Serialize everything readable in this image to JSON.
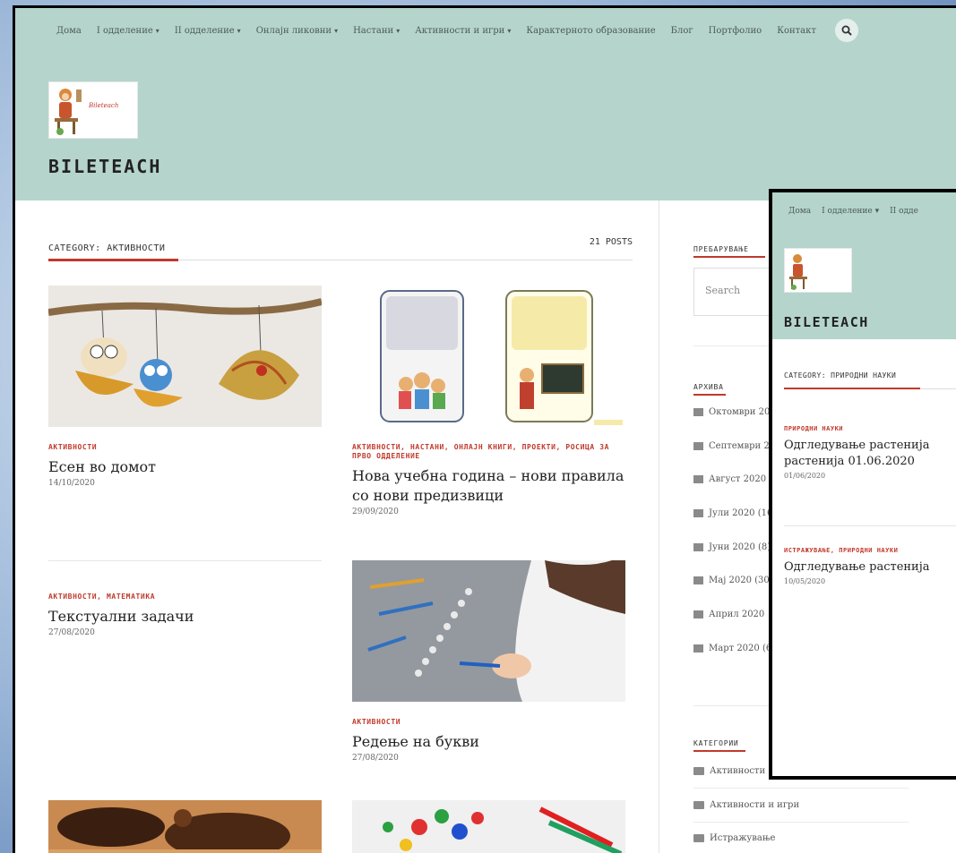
{
  "nav": {
    "items": [
      {
        "label": "Дома",
        "caret": false
      },
      {
        "label": "I одделение",
        "caret": true
      },
      {
        "label": "II одделение",
        "caret": true
      },
      {
        "label": "Онлајн ликовни",
        "caret": true
      },
      {
        "label": "Настани",
        "caret": true
      },
      {
        "label": "Активности и игри",
        "caret": true
      },
      {
        "label": "Карактерното образование",
        "caret": false
      },
      {
        "label": "Блог",
        "caret": false
      },
      {
        "label": "Портфолио",
        "caret": false
      },
      {
        "label": "Контакт",
        "caret": false
      }
    ],
    "caret_glyph": "▾",
    "search_icon": "search-icon"
  },
  "header": {
    "logo_text": "Biletеach",
    "site_title": "BILETEACH"
  },
  "archive": {
    "category_label": "CATEGORY: АКТИВНОСТИ",
    "post_count": "21 POSTS"
  },
  "posts": [
    {
      "categories": "АКТИВНОСТИ",
      "title": "Есен во домот",
      "date": "14/10/2020"
    },
    {
      "categories": "АКТИВНОСТИ, НАСТАНИ, ОНЛАЈН КНИГИ, ПРОЕКТИ, РОСИЦА ЗА ПРВО ОДДЕЛЕНИЕ",
      "title": "Нова учебна година – нови правила со нови предизвици",
      "date": "29/09/2020"
    },
    {
      "categories": "АКТИВНОСТИ, МАТЕМАТИКА",
      "title": "Текстуални задачи",
      "date": "27/08/2020"
    },
    {
      "categories": "АКТИВНОСТИ",
      "title": "Редење на букви",
      "date": "27/08/2020"
    }
  ],
  "sidebar": {
    "search_title": "ПРЕБАРУВАЊЕ",
    "search_placeholder": "Search",
    "archive_title": "АРХИВА",
    "archive_items": [
      "Октомври 20",
      "Септември 2",
      "Август 2020 (",
      "Јули 2020 (16",
      "Јуни 2020 (8)",
      "Мај 2020 (30",
      "Април 2020",
      "Март 2020 (6"
    ],
    "categories_title": "КАТЕГОРИИ",
    "category_items": [
      "Активности",
      "Активности и игри",
      "Истражување"
    ]
  },
  "overlay": {
    "nav_items": [
      "Дома",
      "I одделение ▾",
      "II одде"
    ],
    "site_title": "BILETEACH",
    "category_label": "CATEGORY: ПРИРОДНИ НАУКИ",
    "posts": [
      {
        "categories": "ПРИРОДНИ НАУКИ",
        "title_line1": "Одгледување растенија",
        "title_line2": "растенија 01.06.2020",
        "date": "01/06/2020"
      },
      {
        "categories": "ИСТРАЖУВАЊЕ, ПРИРОДНИ НАУКИ",
        "title_line1": "Одгледување растенија",
        "title_line2": "",
        "date": "10/05/2020"
      }
    ]
  },
  "colors": {
    "header_bg": "#b5d4cc",
    "accent": "#c0392b"
  }
}
